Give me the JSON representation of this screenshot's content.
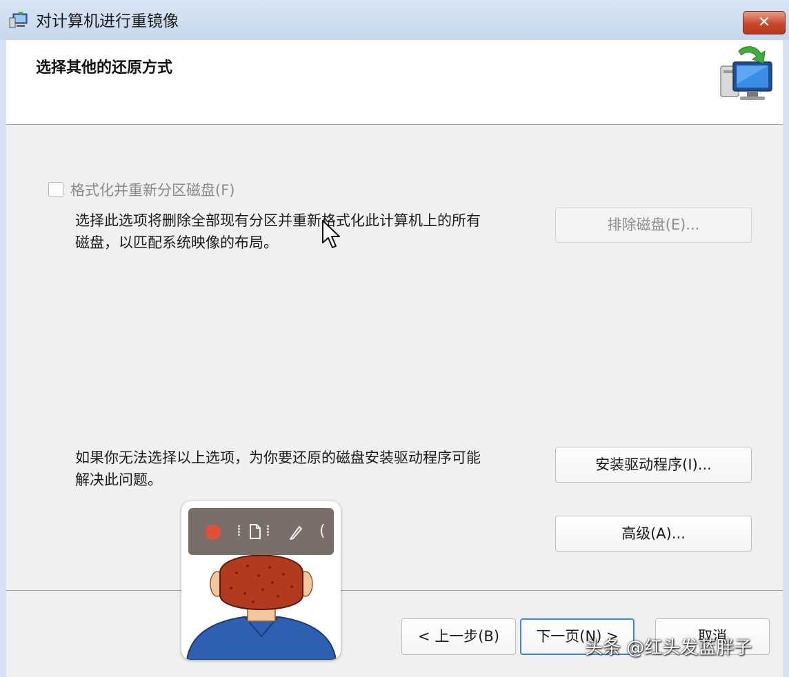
{
  "window": {
    "title": "对计算机进行重镜像",
    "close_label": "✕"
  },
  "header": {
    "title": "选择其他的还原方式",
    "icon": "computer-restore-icon"
  },
  "format_option": {
    "checkbox_label": "格式化并重新分区磁盘(F)",
    "checked": false,
    "enabled": false,
    "description_line1": "选择此选项将删除全部现有分区并重新格式化此计算机上的所有",
    "description_line2": "磁盘，以匹配系统映像的布局。",
    "exclude_button": "排除磁盘(E)..."
  },
  "driver_section": {
    "description_line1": "如果你无法选择以上选项，为你要还原的磁盘安装驱动程序可能",
    "description_line2": "解决此问题。",
    "install_button": "安装驱动程序(I)...",
    "advanced_button": "高级(A)..."
  },
  "footer": {
    "back_button": "< 上一步(B)",
    "next_button": "下一页(N) >",
    "cancel_button": "取消"
  },
  "recorder_overlay": {
    "record_color": "#e2503c",
    "tools": [
      "grip-icon",
      "page-icon",
      "grip-icon",
      "pen-icon"
    ]
  },
  "watermark": {
    "text": "头条 @红头发蓝胖子"
  }
}
